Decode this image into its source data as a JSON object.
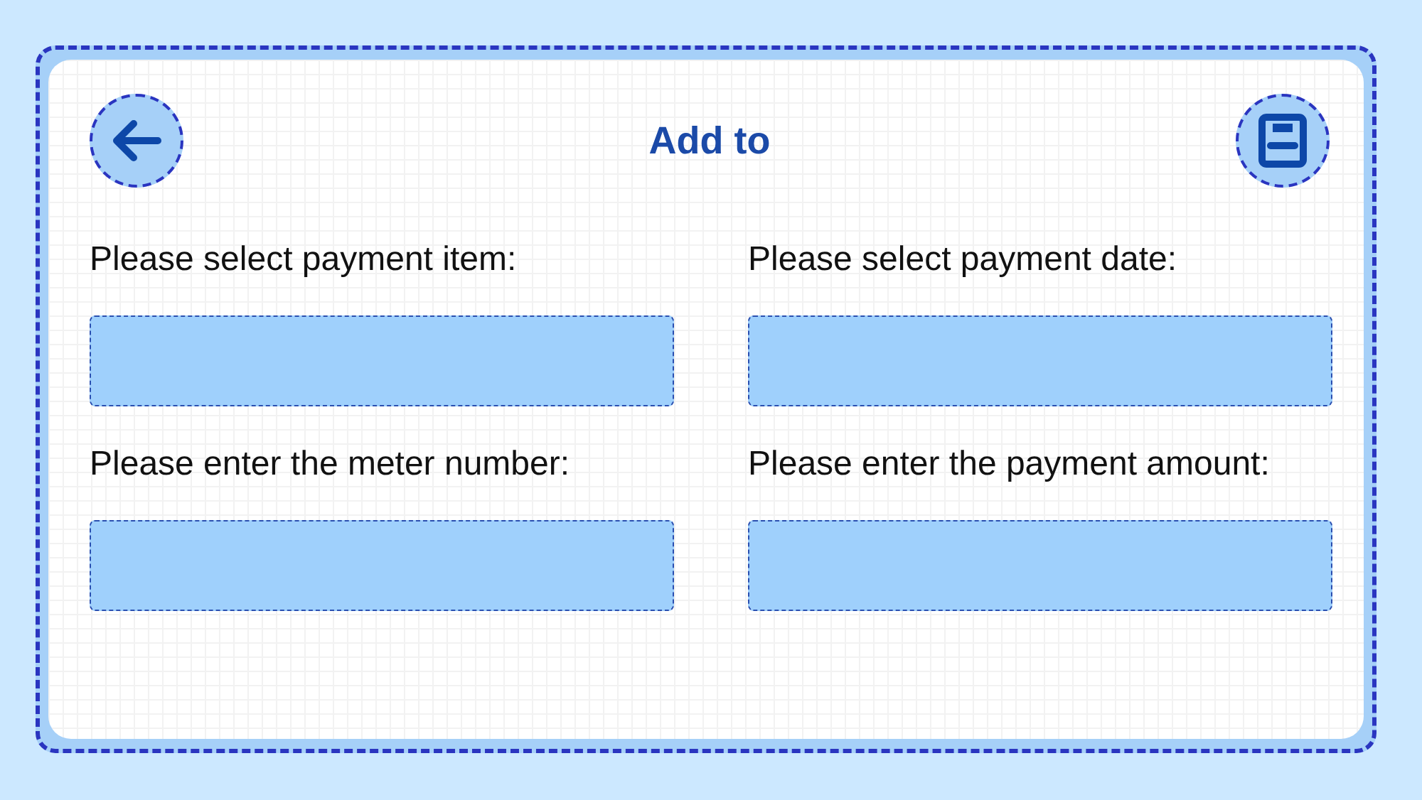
{
  "header": {
    "title": "Add to"
  },
  "fields": [
    {
      "label": "Please select payment item:"
    },
    {
      "label": "Please select payment date:"
    },
    {
      "label": "Please enter the meter number:"
    },
    {
      "label": "Please enter the payment amount:"
    }
  ]
}
